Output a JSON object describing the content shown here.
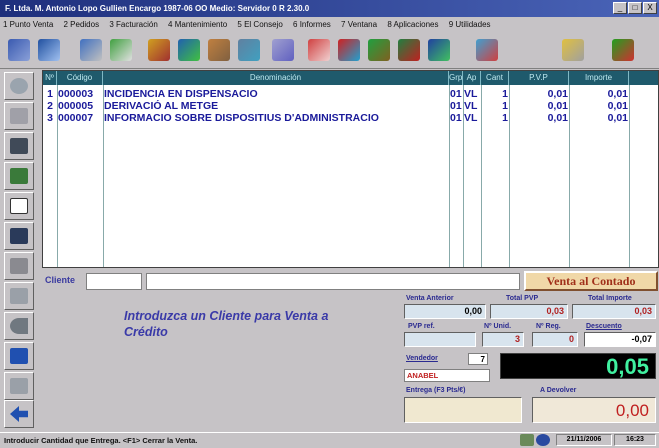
{
  "window": {
    "title": "F. Ltda. M. Antonio Lopo Gullien   Encargo 1987-06 OO   Medio: Servidor 0   R 2.30.0",
    "minimize": "_",
    "maximize": "□",
    "close": "X"
  },
  "menu": [
    "1 Punto Venta",
    "2 Pedidos",
    "3 Facturación",
    "4 Mantenimiento",
    "5 El Consejo",
    "6 Informes",
    "7 Ventana",
    "8 Aplicaciones",
    "9 Utilidades"
  ],
  "toolbar_icons": [
    "people-icon",
    "book-icon",
    "cart-icon",
    "transfer-icon",
    "pencil-icon",
    "truck-icon",
    "boxes-icon",
    "calc-icon",
    "pill-icon",
    "envelope-icon",
    "chart-icon",
    "tree-icon",
    "puzzle-icon",
    "gear-icon",
    "user-icon",
    "printer-icon",
    "exit-icon"
  ],
  "sidebar_icons": [
    "phone-icon",
    "eraser-icon",
    "printer-icon",
    "money-icon",
    "blank-icon",
    "receipt-icon",
    "list-icon",
    "search-icon",
    "arrow-back-icon",
    "rsp-icon",
    "eraser2-icon",
    "back-arrow-icon"
  ],
  "grid": {
    "headers": [
      "Nº",
      "Código",
      "Denominación",
      "Grp",
      "Ap",
      "Cant",
      "P.V.P",
      "Importe"
    ],
    "rows": [
      {
        "n": "1",
        "code": "000003",
        "desc": "INCIDENCIA EN DISPENSACIO",
        "grp": "01",
        "ap": "VL",
        "qty": "1",
        "pvp": "0,01",
        "imp": "0,01"
      },
      {
        "n": "2",
        "code": "000005",
        "desc": "DERIVACIÓ AL METGE",
        "grp": "01",
        "ap": "VL",
        "qty": "1",
        "pvp": "0,01",
        "imp": "0,01"
      },
      {
        "n": "3",
        "code": "000007",
        "desc": "INFORMACIO SOBRE DISPOSITIUS D'ADMINISTRACIO",
        "grp": "01",
        "ap": "VL",
        "qty": "1",
        "pvp": "0,01",
        "imp": "0,01"
      }
    ]
  },
  "client": {
    "label": "Cliente",
    "code": "",
    "name": "",
    "button": "Venta al Contado"
  },
  "message": "Introduzca un Cliente para Venta a Crédito",
  "panel": {
    "venta_anterior_label": "Venta Anterior",
    "venta_anterior": "0,00",
    "total_pvp_label": "Total PVP",
    "total_pvp": "0,03",
    "total_importe_label": "Total Importe",
    "total_importe": "0,03",
    "pvp_ref_label": "PVP ref.",
    "pvp_ref": "",
    "n_unid_label": "Nº Unid.",
    "n_unid": "3",
    "n_reg_label": "Nº Reg.",
    "n_reg": "0",
    "descuento_label": "Descuento",
    "descuento": "-0,07",
    "vendedor_label": "Vendedor",
    "vendedor_num": "7",
    "vendedor_name": "ANABEL",
    "total_big": "0,05",
    "entrega_label": "Entrega (F3 Pts/€)",
    "a_devolver_label": "A Devolver",
    "a_devolver": "0,00"
  },
  "status": {
    "text": "Introducir Cantidad que Entrega.  <F1> Cerrar la Venta.",
    "date": "21/11/2006",
    "time": "16:23"
  },
  "colors": {
    "title_bar": "#1e2f7c",
    "grid_header": "#1f5a6c",
    "row_text": "#1a1a9a",
    "total_green": "#40f0a0",
    "devolver_red": "#c02020"
  }
}
